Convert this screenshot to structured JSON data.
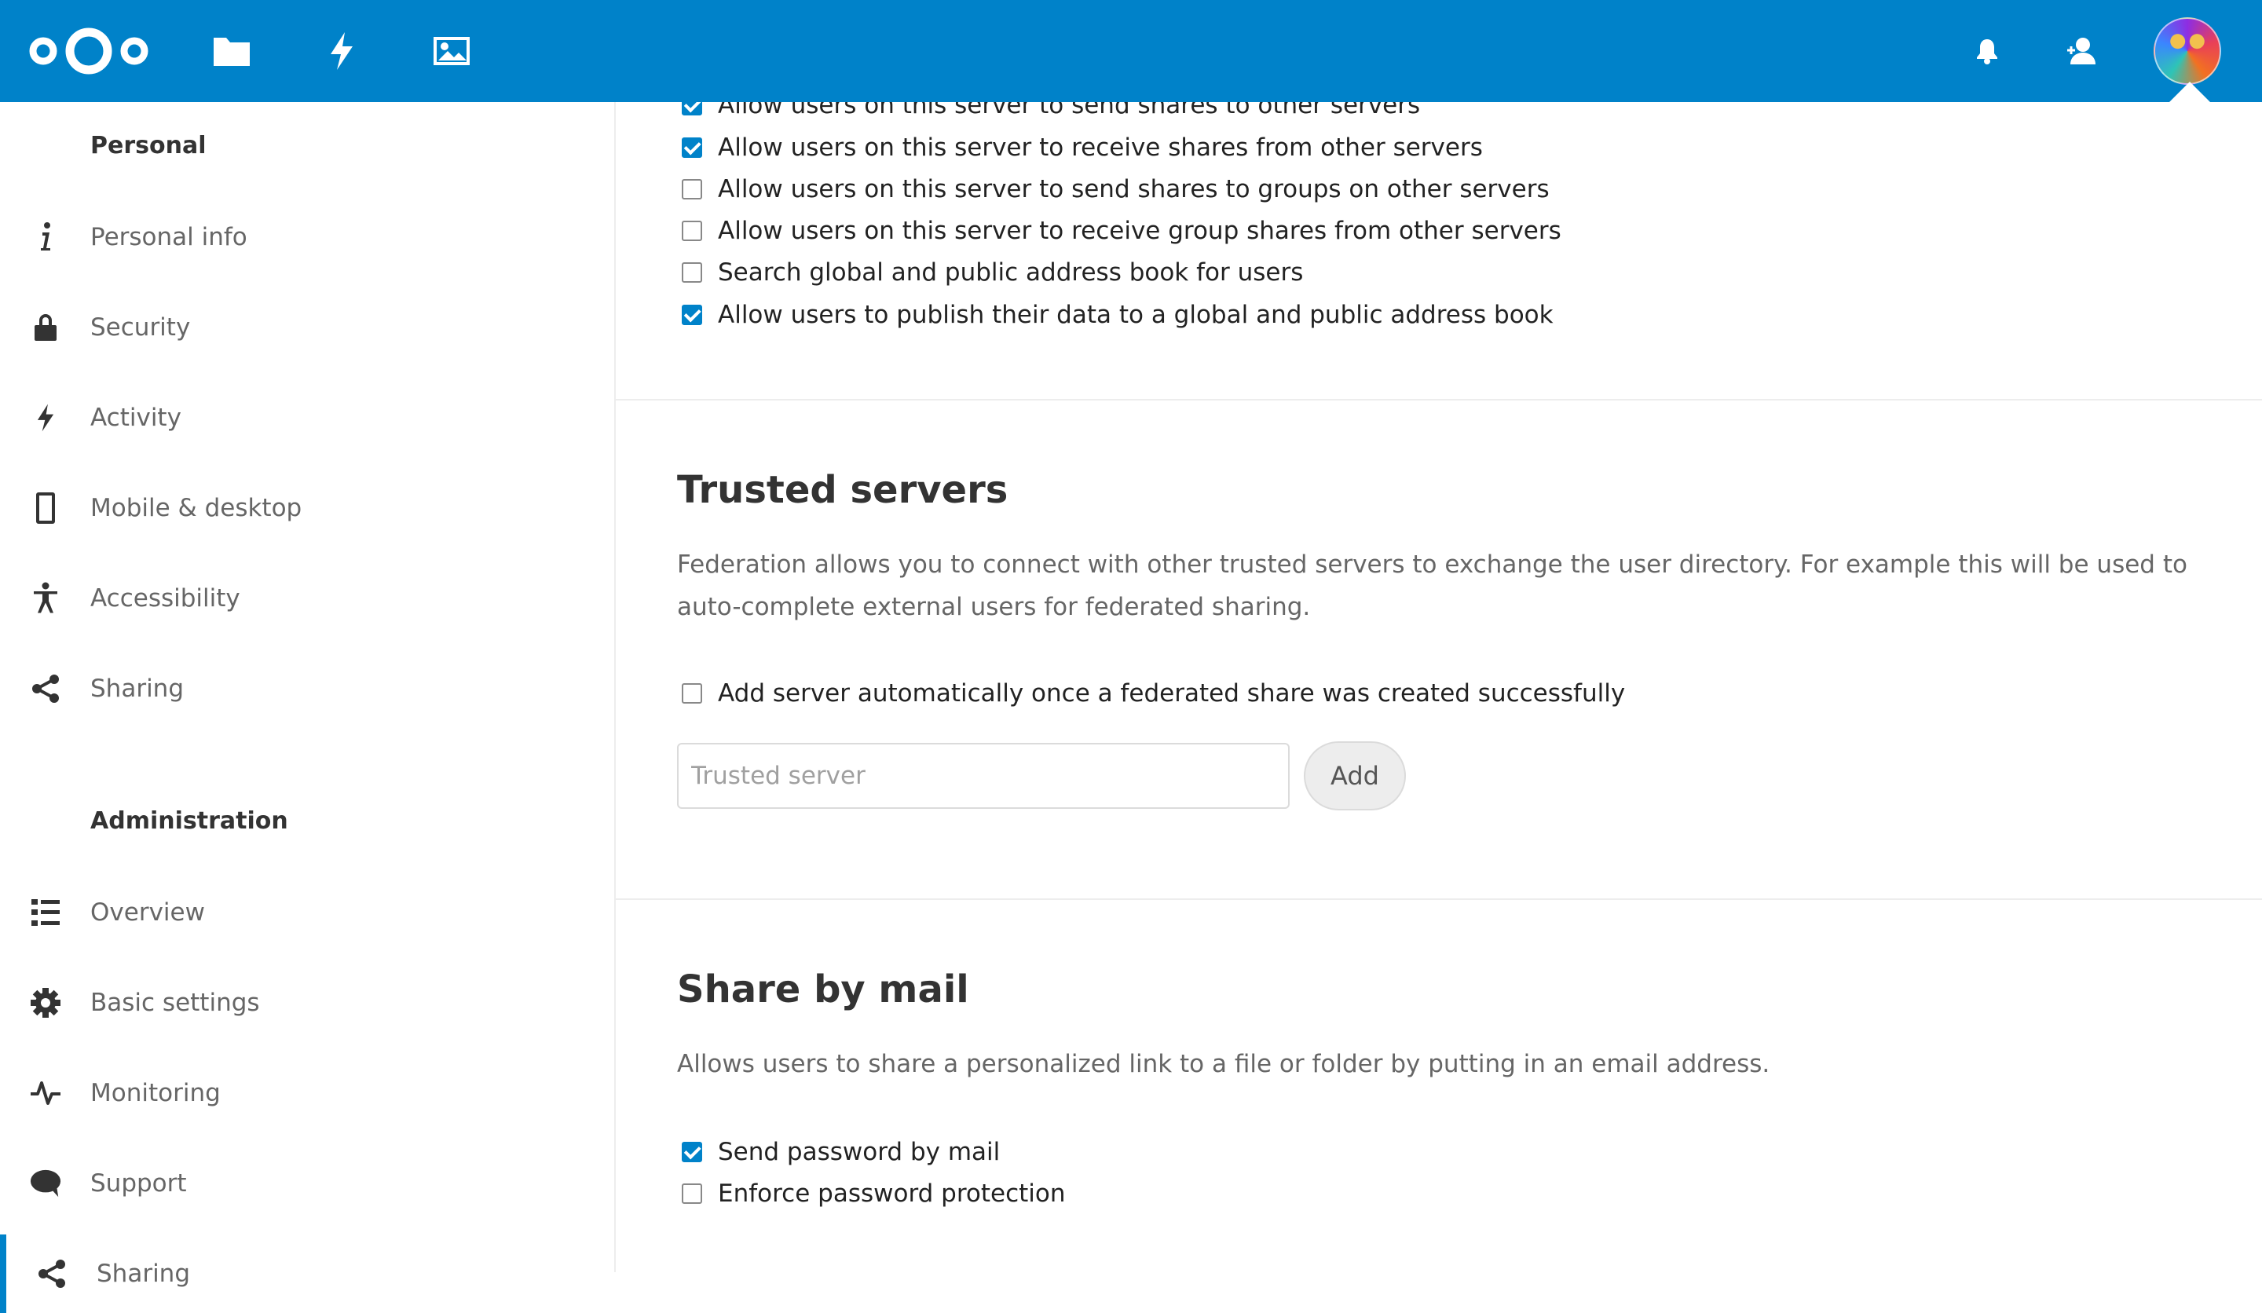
{
  "header": {
    "logo_icon": "nextcloud-logo",
    "nav": [
      {
        "icon": "folder-icon",
        "name": "Files"
      },
      {
        "icon": "activity-icon",
        "name": "Activity"
      },
      {
        "icon": "image-icon",
        "name": "Photos"
      }
    ],
    "right": [
      "bell-icon",
      "contacts-icon",
      "avatar"
    ],
    "accent_color": "#0082c9"
  },
  "sidebar": {
    "personal_heading": "Personal",
    "personal_items": [
      {
        "label": "Personal info",
        "icon": "info-icon"
      },
      {
        "label": "Security",
        "icon": "lock-icon"
      },
      {
        "label": "Activity",
        "icon": "lightning-icon"
      },
      {
        "label": "Mobile & desktop",
        "icon": "phone-icon"
      },
      {
        "label": "Accessibility",
        "icon": "accessibility-icon"
      },
      {
        "label": "Sharing",
        "icon": "share-icon"
      }
    ],
    "admin_heading": "Administration",
    "admin_items": [
      {
        "label": "Overview",
        "icon": "list-icon"
      },
      {
        "label": "Basic settings",
        "icon": "gear-icon"
      },
      {
        "label": "Monitoring",
        "icon": "pulse-icon"
      },
      {
        "label": "Support",
        "icon": "speech-bubble-icon"
      },
      {
        "label": "Sharing",
        "icon": "share-icon",
        "active": true
      }
    ]
  },
  "federation": {
    "options": [
      {
        "label": "Allow users on this server to send shares to other servers",
        "checked": true
      },
      {
        "label": "Allow users on this server to receive shares from other servers",
        "checked": true
      },
      {
        "label": "Allow users on this server to send shares to groups on other servers",
        "checked": false
      },
      {
        "label": "Allow users on this server to receive group shares from other servers",
        "checked": false
      },
      {
        "label": "Search global and public address book for users",
        "checked": false
      },
      {
        "label": "Allow users to publish their data to a global and public address book",
        "checked": true
      }
    ]
  },
  "trusted_servers": {
    "title": "Trusted servers",
    "description": "Federation allows you to connect with other trusted servers to exchange the user directory. For example this will be used to auto-complete external users for federated sharing.",
    "auto_add_label": "Add server automatically once a federated share was created successfully",
    "auto_add_checked": false,
    "input_placeholder": "Trusted server",
    "input_value": "",
    "add_label": "Add"
  },
  "share_by_mail": {
    "title": "Share by mail",
    "description": "Allows users to share a personalized link to a file or folder by putting in an email address.",
    "options": [
      {
        "label": "Send password by mail",
        "checked": true
      },
      {
        "label": "Enforce password protection",
        "checked": false
      }
    ]
  }
}
